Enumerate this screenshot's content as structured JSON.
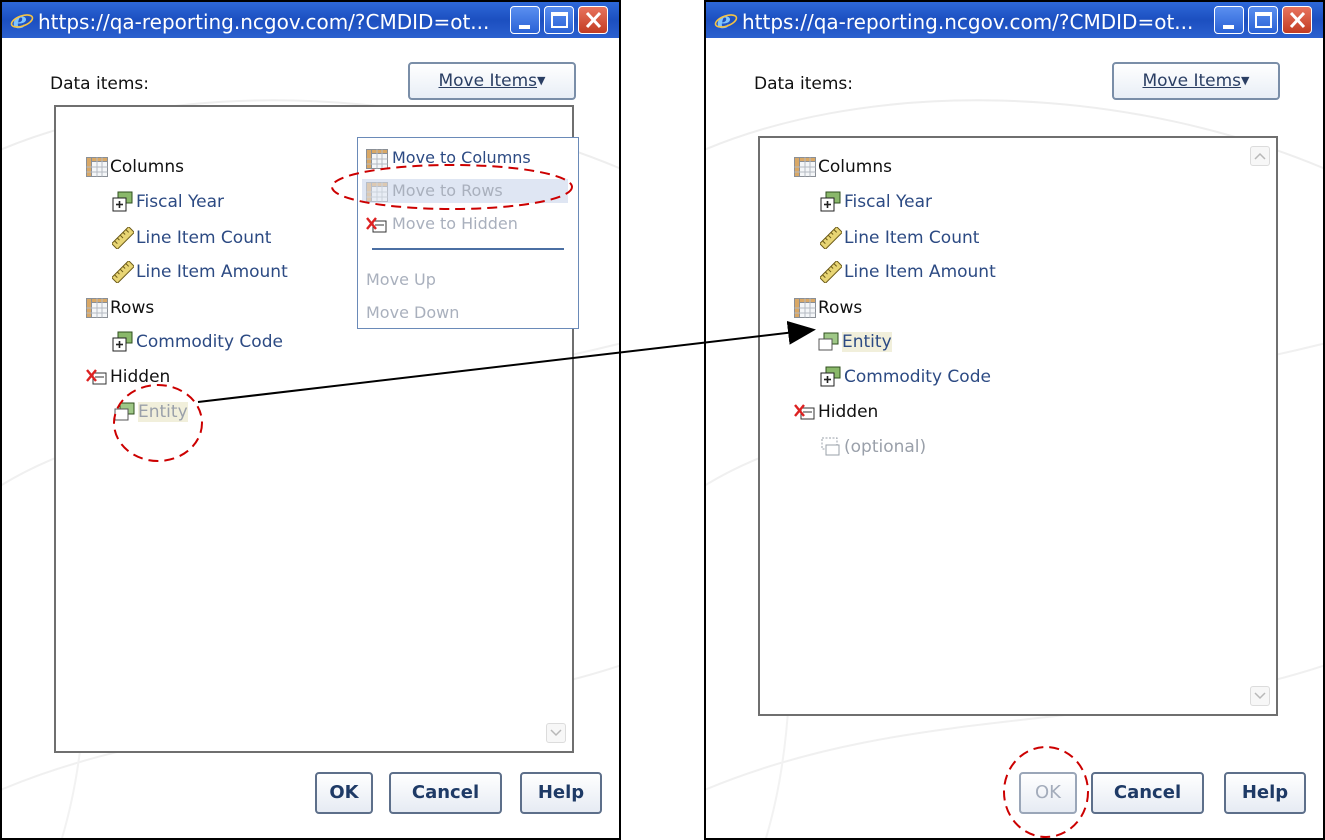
{
  "dialogs": {
    "left": {
      "title": "https://qa-reporting.ncgov.com/?CMDID=ot...",
      "data_items_label": "Data items:",
      "move_items_label": "Move Items",
      "tree": {
        "columns": "Columns",
        "fiscal_year": "Fiscal Year",
        "line_item_count": "Line Item Count",
        "line_item_amount": "Line Item Amount",
        "rows": "Rows",
        "commodity_code": "Commodity Code",
        "hidden": "Hidden",
        "entity": "Entity"
      },
      "menu": {
        "move_to_columns": "Move to Columns",
        "move_to_rows": "Move to Rows",
        "move_to_hidden": "Move to Hidden",
        "move_up": "Move Up",
        "move_down": "Move Down"
      },
      "buttons": {
        "ok": "OK",
        "cancel": "Cancel",
        "help": "Help"
      }
    },
    "right": {
      "title": "https://qa-reporting.ncgov.com/?CMDID=ot...",
      "data_items_label": "Data items:",
      "move_items_label": "Move Items",
      "tree": {
        "columns": "Columns",
        "fiscal_year": "Fiscal Year",
        "line_item_count": "Line Item Count",
        "line_item_amount": "Line Item Amount",
        "rows": "Rows",
        "entity": "Entity",
        "commodity_code": "Commodity Code",
        "hidden": "Hidden",
        "optional": "(optional)"
      },
      "buttons": {
        "ok": "OK",
        "cancel": "Cancel",
        "help": "Help"
      }
    }
  },
  "icons": {
    "browser": "ie-icon",
    "minimize": "minimize-icon",
    "maximize": "maximize-icon",
    "close": "close-icon",
    "table": "table-icon",
    "dimension": "dimension-icon",
    "measure": "ruler-icon",
    "hidden": "hidden-icon",
    "placeholder": "placeholder-icon"
  },
  "colors": {
    "titlebar": "#1c4fc0",
    "item_text": "#2c4a83",
    "annotation": "#cc0000"
  }
}
